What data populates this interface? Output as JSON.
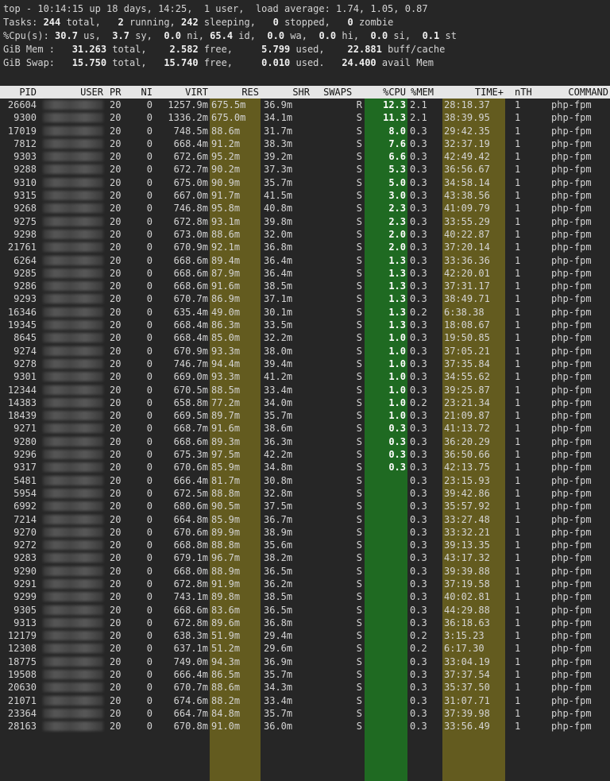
{
  "summary": {
    "line1": "top - 10:14:15 up 18 days, 14:25,  1 user,  load average: 1.74, 1.05, 0.87",
    "tasks": [
      "Tasks: ",
      "244",
      " total,   ",
      "2",
      " running, ",
      "242",
      " sleeping,   ",
      "0",
      " stopped,   ",
      "0",
      " zombie"
    ],
    "cpu": [
      "%Cpu(s): ",
      "30.7",
      " us,  ",
      "3.7",
      " sy,  ",
      "0.0",
      " ni, ",
      "65.4",
      " id,  ",
      "0.0",
      " wa,  ",
      "0.0",
      " hi,  ",
      "0.0",
      " si,  ",
      "0.1",
      " st"
    ],
    "mem": [
      "GiB Mem :   ",
      "31.263",
      " total,    ",
      "2.582",
      " free,     ",
      "5.799",
      " used,    ",
      "22.881",
      " buff/cache"
    ],
    "swap": [
      "GiB Swap:   ",
      "15.750",
      " total,   ",
      "15.740",
      " free,     ",
      "0.010",
      " used.   ",
      "24.400",
      " avail Mem"
    ]
  },
  "columns": [
    "PID",
    "USER",
    "PR",
    "NI",
    "VIRT",
    "RES",
    "SHR",
    "SWAP",
    "S",
    "%CPU",
    "%MEM",
    "TIME+",
    "nTH",
    "COMMAND"
  ],
  "processes": [
    [
      "26604",
      "",
      "20",
      "0",
      "1257.9m",
      "675.5m",
      "36.9m",
      "",
      "R",
      "12.3",
      "2.1",
      "28:18.37",
      "1",
      "php-fpm"
    ],
    [
      "9300",
      "",
      "20",
      "0",
      "1336.2m",
      "675.0m",
      "34.1m",
      "",
      "S",
      "11.3",
      "2.1",
      "38:39.95",
      "1",
      "php-fpm"
    ],
    [
      "17019",
      "",
      "20",
      "0",
      "748.5m",
      "88.6m",
      "31.7m",
      "",
      "S",
      "8.0",
      "0.3",
      "29:42.35",
      "1",
      "php-fpm"
    ],
    [
      "7812",
      "",
      "20",
      "0",
      "668.4m",
      "91.2m",
      "38.3m",
      "",
      "S",
      "7.6",
      "0.3",
      "32:37.19",
      "1",
      "php-fpm"
    ],
    [
      "9303",
      "",
      "20",
      "0",
      "672.6m",
      "95.2m",
      "39.2m",
      "",
      "S",
      "6.6",
      "0.3",
      "42:49.42",
      "1",
      "php-fpm"
    ],
    [
      "9288",
      "",
      "20",
      "0",
      "672.7m",
      "90.2m",
      "37.3m",
      "",
      "S",
      "5.3",
      "0.3",
      "36:56.67",
      "1",
      "php-fpm"
    ],
    [
      "9310",
      "",
      "20",
      "0",
      "675.0m",
      "90.9m",
      "35.7m",
      "",
      "S",
      "5.0",
      "0.3",
      "34:58.14",
      "1",
      "php-fpm"
    ],
    [
      "9315",
      "",
      "20",
      "0",
      "667.0m",
      "91.7m",
      "41.5m",
      "",
      "S",
      "3.0",
      "0.3",
      "43:38.56",
      "1",
      "php-fpm"
    ],
    [
      "9268",
      "",
      "20",
      "0",
      "746.8m",
      "95.8m",
      "40.8m",
      "",
      "S",
      "2.3",
      "0.3",
      "41:09.79",
      "1",
      "php-fpm"
    ],
    [
      "9275",
      "",
      "20",
      "0",
      "672.8m",
      "93.1m",
      "39.8m",
      "",
      "S",
      "2.3",
      "0.3",
      "33:55.29",
      "1",
      "php-fpm"
    ],
    [
      "9298",
      "",
      "20",
      "0",
      "673.0m",
      "88.6m",
      "32.0m",
      "",
      "S",
      "2.0",
      "0.3",
      "40:22.87",
      "1",
      "php-fpm"
    ],
    [
      "21761",
      "",
      "20",
      "0",
      "670.9m",
      "92.1m",
      "36.8m",
      "",
      "S",
      "2.0",
      "0.3",
      "37:20.14",
      "1",
      "php-fpm"
    ],
    [
      "6264",
      "",
      "20",
      "0",
      "668.6m",
      "89.4m",
      "36.4m",
      "",
      "S",
      "1.3",
      "0.3",
      "33:36.36",
      "1",
      "php-fpm"
    ],
    [
      "9285",
      "",
      "20",
      "0",
      "668.6m",
      "87.9m",
      "36.4m",
      "",
      "S",
      "1.3",
      "0.3",
      "42:20.01",
      "1",
      "php-fpm"
    ],
    [
      "9286",
      "",
      "20",
      "0",
      "668.6m",
      "91.6m",
      "38.5m",
      "",
      "S",
      "1.3",
      "0.3",
      "37:31.17",
      "1",
      "php-fpm"
    ],
    [
      "9293",
      "",
      "20",
      "0",
      "670.7m",
      "86.9m",
      "37.1m",
      "",
      "S",
      "1.3",
      "0.3",
      "38:49.71",
      "1",
      "php-fpm"
    ],
    [
      "16346",
      "",
      "20",
      "0",
      "635.4m",
      "49.0m",
      "30.1m",
      "",
      "S",
      "1.3",
      "0.2",
      "6:38.38",
      "1",
      "php-fpm"
    ],
    [
      "19345",
      "",
      "20",
      "0",
      "668.4m",
      "86.3m",
      "33.5m",
      "",
      "S",
      "1.3",
      "0.3",
      "18:08.67",
      "1",
      "php-fpm"
    ],
    [
      "8645",
      "",
      "20",
      "0",
      "668.4m",
      "85.0m",
      "32.2m",
      "",
      "S",
      "1.0",
      "0.3",
      "19:50.85",
      "1",
      "php-fpm"
    ],
    [
      "9274",
      "",
      "20",
      "0",
      "670.9m",
      "93.3m",
      "38.0m",
      "",
      "S",
      "1.0",
      "0.3",
      "37:05.21",
      "1",
      "php-fpm"
    ],
    [
      "9278",
      "",
      "20",
      "0",
      "746.7m",
      "94.4m",
      "39.4m",
      "",
      "S",
      "1.0",
      "0.3",
      "37:35.84",
      "1",
      "php-fpm"
    ],
    [
      "9301",
      "",
      "20",
      "0",
      "669.0m",
      "93.3m",
      "41.2m",
      "",
      "S",
      "1.0",
      "0.3",
      "34:55.62",
      "1",
      "php-fpm"
    ],
    [
      "12344",
      "",
      "20",
      "0",
      "670.5m",
      "88.5m",
      "33.4m",
      "",
      "S",
      "1.0",
      "0.3",
      "39:25.87",
      "1",
      "php-fpm"
    ],
    [
      "14383",
      "",
      "20",
      "0",
      "658.8m",
      "77.2m",
      "34.0m",
      "",
      "S",
      "1.0",
      "0.2",
      "23:21.34",
      "1",
      "php-fpm"
    ],
    [
      "18439",
      "",
      "20",
      "0",
      "669.5m",
      "89.7m",
      "35.7m",
      "",
      "S",
      "1.0",
      "0.3",
      "21:09.87",
      "1",
      "php-fpm"
    ],
    [
      "9271",
      "",
      "20",
      "0",
      "668.7m",
      "91.6m",
      "38.6m",
      "",
      "S",
      "0.3",
      "0.3",
      "41:13.72",
      "1",
      "php-fpm"
    ],
    [
      "9280",
      "",
      "20",
      "0",
      "668.6m",
      "89.3m",
      "36.3m",
      "",
      "S",
      "0.3",
      "0.3",
      "36:20.29",
      "1",
      "php-fpm"
    ],
    [
      "9296",
      "",
      "20",
      "0",
      "675.3m",
      "97.5m",
      "42.2m",
      "",
      "S",
      "0.3",
      "0.3",
      "36:50.66",
      "1",
      "php-fpm"
    ],
    [
      "9317",
      "",
      "20",
      "0",
      "670.6m",
      "85.9m",
      "34.8m",
      "",
      "S",
      "0.3",
      "0.3",
      "42:13.75",
      "1",
      "php-fpm"
    ],
    [
      "5481",
      "",
      "20",
      "0",
      "666.4m",
      "81.7m",
      "30.8m",
      "",
      "S",
      "",
      "0.3",
      "23:15.93",
      "1",
      "php-fpm"
    ],
    [
      "5954",
      "",
      "20",
      "0",
      "672.5m",
      "88.8m",
      "32.8m",
      "",
      "S",
      "",
      "0.3",
      "39:42.86",
      "1",
      "php-fpm"
    ],
    [
      "6992",
      "",
      "20",
      "0",
      "680.6m",
      "90.5m",
      "37.5m",
      "",
      "S",
      "",
      "0.3",
      "35:57.92",
      "1",
      "php-fpm"
    ],
    [
      "7214",
      "",
      "20",
      "0",
      "664.8m",
      "85.9m",
      "36.7m",
      "",
      "S",
      "",
      "0.3",
      "33:27.48",
      "1",
      "php-fpm"
    ],
    [
      "9270",
      "",
      "20",
      "0",
      "670.6m",
      "89.9m",
      "38.9m",
      "",
      "S",
      "",
      "0.3",
      "33:32.21",
      "1",
      "php-fpm"
    ],
    [
      "9272",
      "",
      "20",
      "0",
      "668.8m",
      "88.8m",
      "35.6m",
      "",
      "S",
      "",
      "0.3",
      "39:13.35",
      "1",
      "php-fpm"
    ],
    [
      "9283",
      "",
      "20",
      "0",
      "679.1m",
      "96.7m",
      "38.2m",
      "",
      "S",
      "",
      "0.3",
      "43:17.32",
      "1",
      "php-fpm"
    ],
    [
      "9290",
      "",
      "20",
      "0",
      "668.0m",
      "88.9m",
      "36.5m",
      "",
      "S",
      "",
      "0.3",
      "39:39.88",
      "1",
      "php-fpm"
    ],
    [
      "9291",
      "",
      "20",
      "0",
      "672.8m",
      "91.9m",
      "36.2m",
      "",
      "S",
      "",
      "0.3",
      "37:19.58",
      "1",
      "php-fpm"
    ],
    [
      "9299",
      "",
      "20",
      "0",
      "743.1m",
      "89.8m",
      "38.5m",
      "",
      "S",
      "",
      "0.3",
      "40:02.81",
      "1",
      "php-fpm"
    ],
    [
      "9305",
      "",
      "20",
      "0",
      "668.6m",
      "83.6m",
      "36.5m",
      "",
      "S",
      "",
      "0.3",
      "44:29.88",
      "1",
      "php-fpm"
    ],
    [
      "9313",
      "",
      "20",
      "0",
      "672.8m",
      "89.6m",
      "36.8m",
      "",
      "S",
      "",
      "0.3",
      "36:18.63",
      "1",
      "php-fpm"
    ],
    [
      "12179",
      "",
      "20",
      "0",
      "638.3m",
      "51.9m",
      "29.4m",
      "",
      "S",
      "",
      "0.2",
      "3:15.23",
      "1",
      "php-fpm"
    ],
    [
      "12308",
      "",
      "20",
      "0",
      "637.1m",
      "51.2m",
      "29.6m",
      "",
      "S",
      "",
      "0.2",
      "6:17.30",
      "1",
      "php-fpm"
    ],
    [
      "18775",
      "",
      "20",
      "0",
      "749.0m",
      "94.3m",
      "36.9m",
      "",
      "S",
      "",
      "0.3",
      "33:04.19",
      "1",
      "php-fpm"
    ],
    [
      "19508",
      "",
      "20",
      "0",
      "666.4m",
      "86.5m",
      "35.7m",
      "",
      "S",
      "",
      "0.3",
      "37:37.54",
      "1",
      "php-fpm"
    ],
    [
      "20630",
      "",
      "20",
      "0",
      "670.7m",
      "88.6m",
      "34.3m",
      "",
      "S",
      "",
      "0.3",
      "35:37.50",
      "1",
      "php-fpm"
    ],
    [
      "21071",
      "",
      "20",
      "0",
      "674.6m",
      "88.2m",
      "33.4m",
      "",
      "S",
      "",
      "0.3",
      "31:07.71",
      "1",
      "php-fpm"
    ],
    [
      "23364",
      "",
      "20",
      "0",
      "664.7m",
      "84.8m",
      "35.7m",
      "",
      "S",
      "",
      "0.3",
      "37:39.98",
      "1",
      "php-fpm"
    ],
    [
      "28163",
      "",
      "20",
      "0",
      "670.8m",
      "91.0m",
      "36.0m",
      "",
      "S",
      "",
      "0.3",
      "33:56.49",
      "1",
      "php-fpm"
    ]
  ]
}
